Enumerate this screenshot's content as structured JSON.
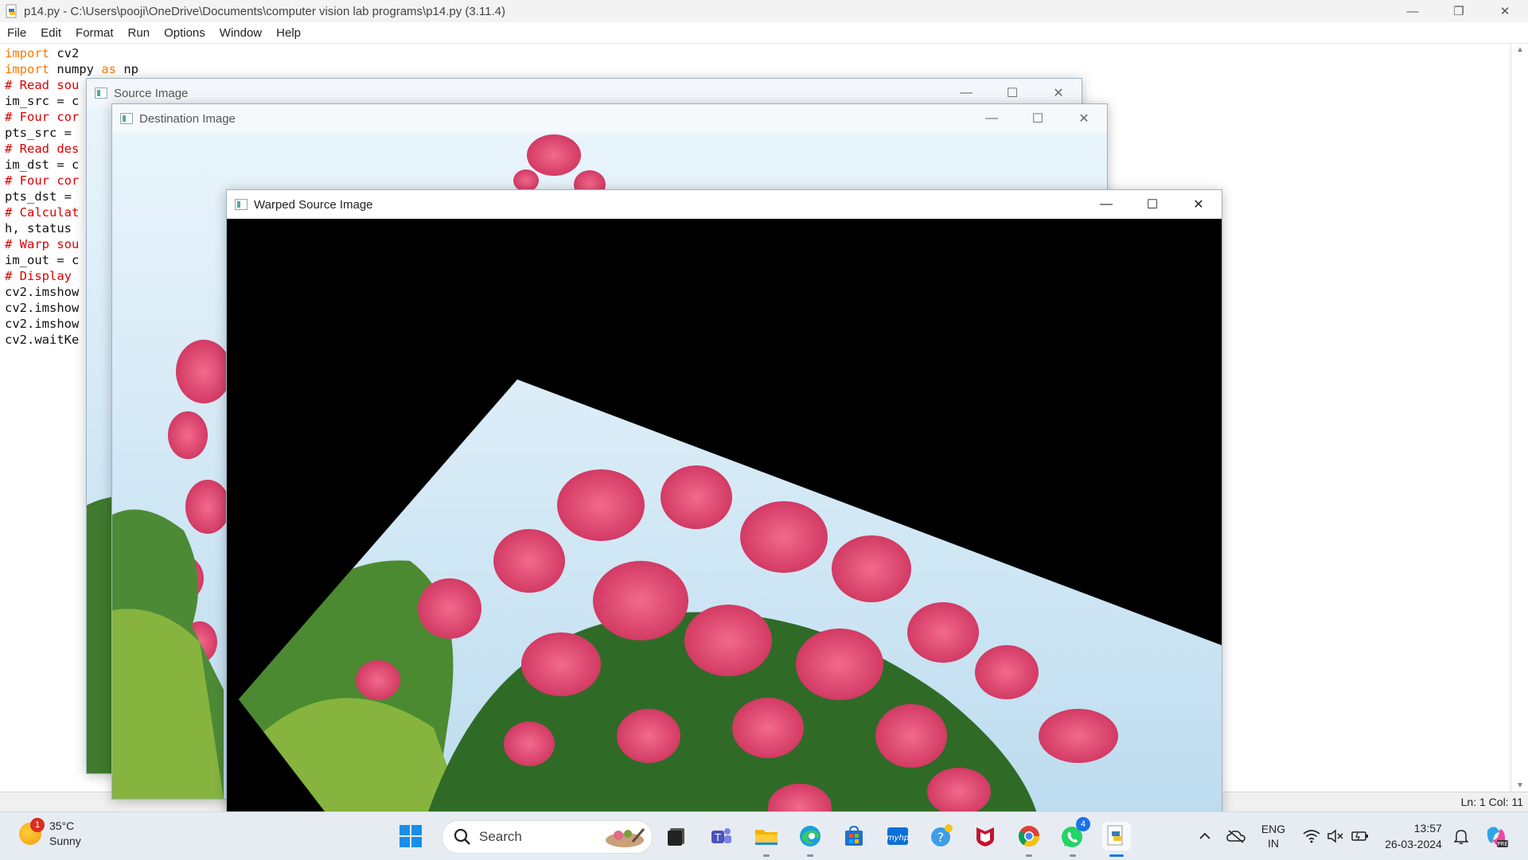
{
  "editor": {
    "title": "p14.py - C:\\Users\\pooji\\OneDrive\\Documents\\computer vision lab programs\\p14.py (3.11.4)",
    "menu": [
      "File",
      "Edit",
      "Format",
      "Run",
      "Options",
      "Window",
      "Help"
    ],
    "code": [
      {
        "kw": "import",
        "text": " cv2"
      },
      {
        "kw": "import",
        "text": " numpy ",
        "kw2": "as",
        "text2": " np"
      },
      {
        "comment": "# Read sou"
      },
      {
        "text": "im_src = c"
      },
      {
        "comment": "# Four cor"
      },
      {
        "text": "pts_src = "
      },
      {
        "comment": "# Read des"
      },
      {
        "text": "im_dst = c"
      },
      {
        "comment": "# Four cor"
      },
      {
        "text": "pts_dst = "
      },
      {
        "comment": "# Calculat"
      },
      {
        "text": "h, status "
      },
      {
        "comment": "# Warp sou"
      },
      {
        "text": "im_out = c"
      },
      {
        "comment": "# Display "
      },
      {
        "text": "cv2.imshow"
      },
      {
        "text": "cv2.imshow"
      },
      {
        "text": "cv2.imshow"
      },
      {
        "text": "cv2.waitKe"
      }
    ],
    "status": "Ln: 1   Col: 11"
  },
  "windows": {
    "source": {
      "title": "Source Image"
    },
    "destination": {
      "title": "Destination Image"
    },
    "warped": {
      "title": "Warped Source Image"
    }
  },
  "taskbar": {
    "weather": {
      "temp": "35°C",
      "condition": "Sunny",
      "badge": "1"
    },
    "search_placeholder": "Search",
    "apps": [
      "windows-start-icon",
      "search-icon",
      "task-view-icon",
      "teams-icon",
      "file-explorer-icon",
      "edge-icon",
      "microsoft-store-icon",
      "myhp-icon",
      "copilot-icon",
      "mcafee-icon",
      "chrome-icon",
      "whatsapp-icon",
      "python-idle-icon"
    ],
    "whatsapp_badge": "4",
    "language": {
      "line1": "ENG",
      "line2": "IN"
    },
    "clock": {
      "time": "13:57",
      "date": "26-03-2024"
    }
  },
  "colors": {
    "keyword": "#ff7700",
    "comment": "#dd0000",
    "taskbar": "#e7ecf3"
  }
}
